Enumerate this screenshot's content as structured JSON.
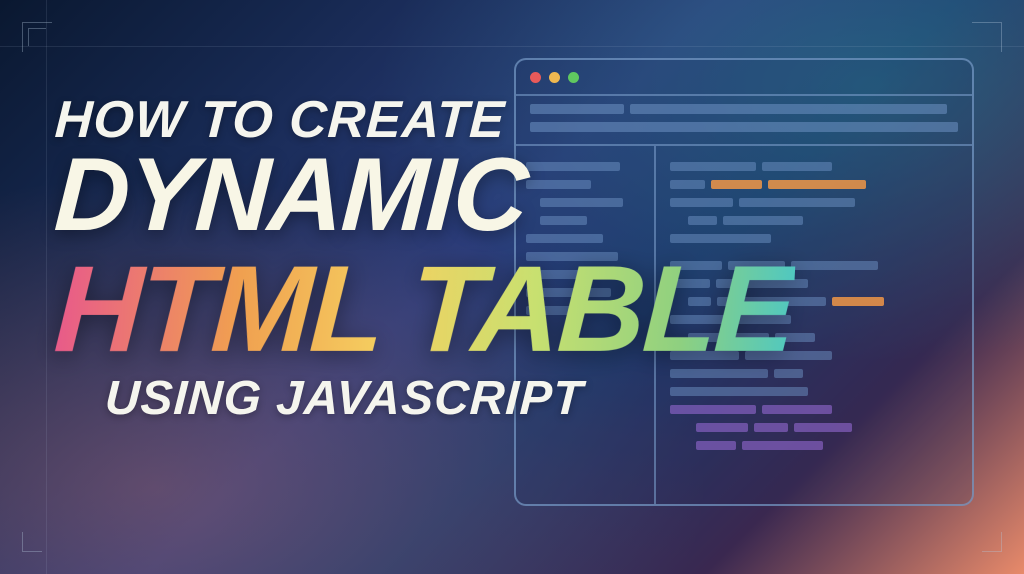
{
  "title": {
    "line1": "HOW TO CREATE",
    "line2": "DYNAMIC",
    "line3": "HTML TABLE",
    "line4": "USING JAVASCRIPT"
  },
  "decorative": {
    "traffic_lights": [
      "close",
      "minimize",
      "maximize"
    ]
  }
}
